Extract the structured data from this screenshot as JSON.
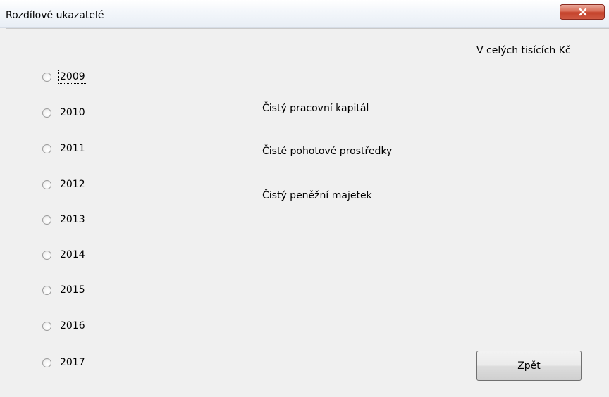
{
  "window": {
    "title": "Rozdílové ukazatelé"
  },
  "units_note": "V celých tisících Kč",
  "years": [
    {
      "label": "2009",
      "selected": false,
      "focused": true
    },
    {
      "label": "2010",
      "selected": false,
      "focused": false
    },
    {
      "label": "2011",
      "selected": false,
      "focused": false
    },
    {
      "label": "2012",
      "selected": false,
      "focused": false
    },
    {
      "label": "2013",
      "selected": false,
      "focused": false
    },
    {
      "label": "2014",
      "selected": false,
      "focused": false
    },
    {
      "label": "2015",
      "selected": false,
      "focused": false
    },
    {
      "label": "2016",
      "selected": false,
      "focused": false
    },
    {
      "label": "2017",
      "selected": false,
      "focused": false
    }
  ],
  "indicators": [
    {
      "label": "Čistý pracovní kapitál"
    },
    {
      "label": "Čisté pohotové prostředky"
    },
    {
      "label": "Čistý peněžní majetek"
    }
  ],
  "buttons": {
    "back_label": "Zpět"
  },
  "icons": {
    "close": "close-icon"
  },
  "colors": {
    "close_button": "#c4422b",
    "background": "#f0f0f0"
  }
}
